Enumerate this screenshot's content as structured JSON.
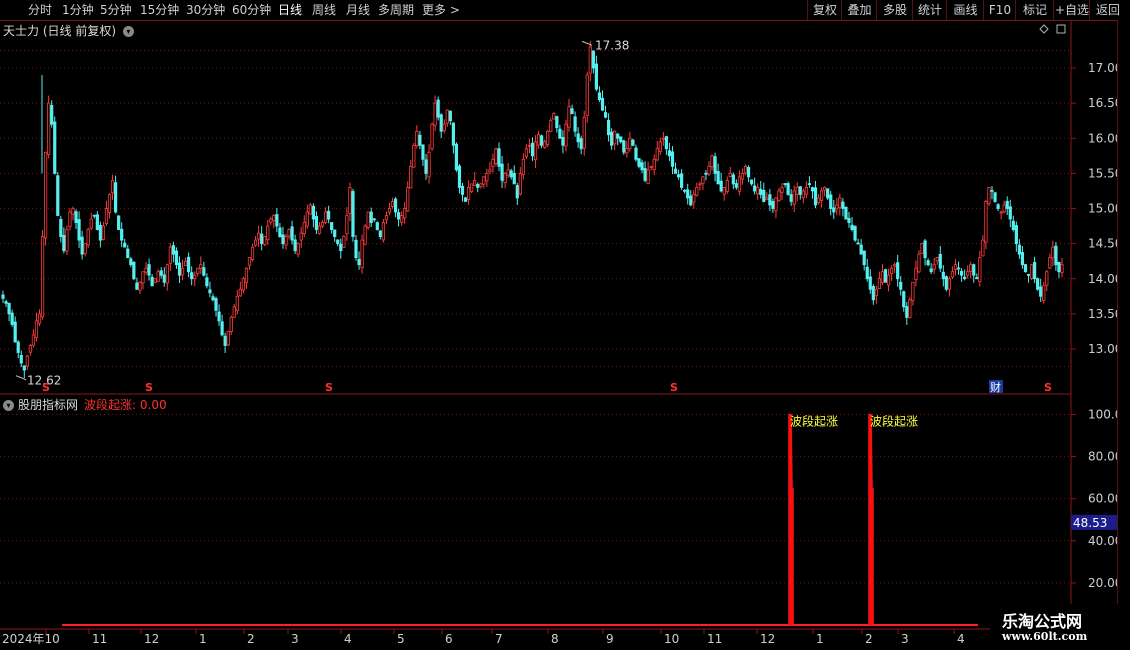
{
  "toolbar": {
    "periods": [
      {
        "label": "分时",
        "active": false
      },
      {
        "label": "1分钟",
        "active": false
      },
      {
        "label": "5分钟",
        "active": false
      },
      {
        "label": "15分钟",
        "active": false
      },
      {
        "label": "30分钟",
        "active": false
      },
      {
        "label": "60分钟",
        "active": false
      },
      {
        "label": "日线",
        "active": true
      },
      {
        "label": "周线",
        "active": false
      },
      {
        "label": "月线",
        "active": false
      },
      {
        "label": "多周期",
        "active": false
      },
      {
        "label": "更多",
        "active": false
      }
    ],
    "more_arrow": ">",
    "right_buttons": [
      "复权",
      "叠加",
      "多股",
      "统计",
      "画线",
      "F10",
      "标记",
      "+自选",
      "返回"
    ]
  },
  "main_chart": {
    "stock_name": "天士力",
    "mode": "(日线 前复权)",
    "high_label": "17.38",
    "low_label": "12.62",
    "y_ticks": [
      "17.00",
      "16.50",
      "16.00",
      "15.50",
      "15.00",
      "14.50",
      "14.00",
      "13.50",
      "13.00"
    ],
    "markers": [
      {
        "label": "S",
        "type": "dividend"
      },
      {
        "label": "S",
        "type": "dividend"
      },
      {
        "label": "S",
        "type": "dividend"
      },
      {
        "label": "S",
        "type": "dividend"
      },
      {
        "label": "财",
        "type": "finance"
      },
      {
        "label": "S",
        "type": "dividend"
      }
    ],
    "colors": {
      "up": "#ff3c3c",
      "down": "#54f0f0",
      "grid": "#7a1010",
      "axis_text": "#d0d0d0"
    }
  },
  "indicator": {
    "source_name": "股朋指标网",
    "line_name": "波段起涨",
    "line_value": "0.00",
    "signal_label": "波段起涨",
    "y_ticks": [
      "100.0",
      "80.00",
      "60.00",
      "40.00",
      "20.00"
    ],
    "cursor_value": "48.53"
  },
  "x_axis": {
    "labels": [
      "2024年10",
      "11",
      "12",
      "1",
      "2",
      "3",
      "4",
      "5",
      "6",
      "7",
      "8",
      "9",
      "10",
      "11",
      "12",
      "1",
      "2",
      "3",
      "4"
    ]
  },
  "chart_data": [
    {
      "type": "candlestick",
      "title": "天士力(日线 前复权)",
      "y_range": [
        12.45,
        17.55
      ],
      "annotations": {
        "high": 17.38,
        "low": 12.62
      },
      "closes": [
        13.72,
        13.65,
        13.5,
        13.35,
        13.1,
        12.95,
        12.8,
        12.7,
        12.9,
        13.05,
        13.2,
        13.4,
        13.5,
        14.6,
        15.8,
        16.5,
        16.2,
        15.5,
        14.9,
        14.6,
        14.4,
        14.7,
        14.95,
        15.0,
        14.8,
        14.55,
        14.35,
        14.5,
        14.7,
        14.85,
        14.9,
        14.7,
        14.55,
        14.75,
        15.0,
        15.2,
        15.4,
        14.95,
        14.7,
        14.55,
        14.45,
        14.3,
        14.2,
        14.0,
        13.85,
        13.95,
        14.1,
        14.15,
        14.05,
        13.9,
        14.0,
        14.1,
        14.05,
        13.95,
        14.2,
        14.45,
        14.35,
        14.2,
        14.05,
        14.15,
        14.25,
        14.1,
        14.0,
        14.05,
        14.15,
        14.2,
        14.05,
        13.9,
        13.8,
        13.7,
        13.55,
        13.4,
        13.2,
        13.05,
        13.25,
        13.45,
        13.6,
        13.75,
        13.85,
        14.0,
        14.15,
        14.3,
        14.45,
        14.55,
        14.65,
        14.5,
        14.6,
        14.75,
        14.85,
        14.9,
        14.75,
        14.6,
        14.5,
        14.6,
        14.7,
        14.55,
        14.4,
        14.5,
        14.65,
        14.8,
        14.95,
        15.05,
        14.85,
        14.7,
        14.75,
        14.8,
        14.95,
        14.85,
        14.7,
        14.6,
        14.5,
        14.4,
        14.6,
        14.9,
        15.3,
        14.6,
        14.3,
        14.2,
        14.55,
        14.75,
        14.95,
        14.8,
        14.85,
        14.7,
        14.6,
        14.8,
        14.9,
        15.0,
        15.1,
        14.95,
        14.85,
        14.9,
        15.0,
        15.3,
        15.6,
        15.9,
        16.1,
        15.9,
        15.7,
        15.5,
        15.8,
        16.2,
        16.5,
        16.3,
        16.1,
        16.2,
        16.4,
        16.25,
        15.9,
        15.55,
        15.3,
        15.2,
        15.1,
        15.3,
        15.35,
        15.4,
        15.3,
        15.35,
        15.45,
        15.5,
        15.55,
        15.7,
        15.85,
        15.6,
        15.4,
        15.5,
        15.55,
        15.45,
        15.35,
        15.15,
        15.5,
        15.7,
        15.85,
        15.9,
        15.75,
        15.95,
        16.05,
        15.9,
        15.95,
        16.1,
        16.25,
        16.35,
        16.15,
        16.0,
        15.9,
        16.2,
        16.45,
        16.35,
        16.1,
        15.95,
        15.85,
        16.3,
        16.9,
        17.3,
        17.0,
        16.7,
        16.55,
        16.4,
        16.3,
        16.05,
        15.9,
        16.1,
        16.0,
        15.95,
        15.8,
        15.85,
        16.0,
        15.9,
        15.7,
        15.6,
        15.55,
        15.4,
        15.55,
        15.6,
        15.7,
        15.85,
        15.95,
        16.0,
        15.85,
        15.75,
        15.6,
        15.5,
        15.45,
        15.3,
        15.25,
        15.15,
        15.05,
        15.2,
        15.3,
        15.35,
        15.45,
        15.5,
        15.6,
        15.75,
        15.5,
        15.35,
        15.25,
        15.3,
        15.4,
        15.5,
        15.35,
        15.3,
        15.45,
        15.5,
        15.6,
        15.45,
        15.35,
        15.25,
        15.3,
        15.2,
        15.1,
        15.15,
        15.05,
        15.0,
        15.15,
        15.25,
        15.3,
        15.35,
        15.2,
        15.1,
        15.25,
        15.3,
        15.2,
        15.25,
        15.3,
        15.35,
        15.25,
        15.05,
        15.15,
        15.25,
        15.3,
        15.15,
        15.0,
        14.95,
        15.05,
        15.15,
        15.0,
        14.85,
        14.8,
        14.7,
        14.55,
        14.5,
        14.35,
        14.2,
        14.0,
        13.85,
        13.7,
        13.85,
        14.0,
        14.1,
        13.95,
        14.05,
        14.15,
        14.2,
        14.0,
        13.85,
        13.6,
        13.45,
        13.7,
        13.95,
        14.15,
        14.35,
        14.5,
        14.3,
        14.2,
        14.1,
        14.2,
        14.3,
        14.15,
        14.0,
        13.85,
        14.0,
        14.1,
        14.2,
        14.15,
        14.05,
        14.0,
        14.1,
        14.2,
        14.05,
        14.0,
        14.3,
        14.55,
        15.1,
        15.3,
        15.25,
        15.1,
        15.0,
        14.95,
        15.05,
        15.0,
        14.85,
        14.7,
        14.5,
        14.35,
        14.2,
        14.1,
        14.05,
        14.2,
        14.0,
        13.85,
        13.75,
        13.9,
        14.1,
        14.3,
        14.45,
        14.2,
        14.1,
        14.2
      ],
      "signals": [
        {
          "label": "波段起涨",
          "value": 100.0
        },
        {
          "label": "波段起涨",
          "value": 100.0
        }
      ],
      "indicator_range": [
        0,
        105
      ]
    }
  ]
}
